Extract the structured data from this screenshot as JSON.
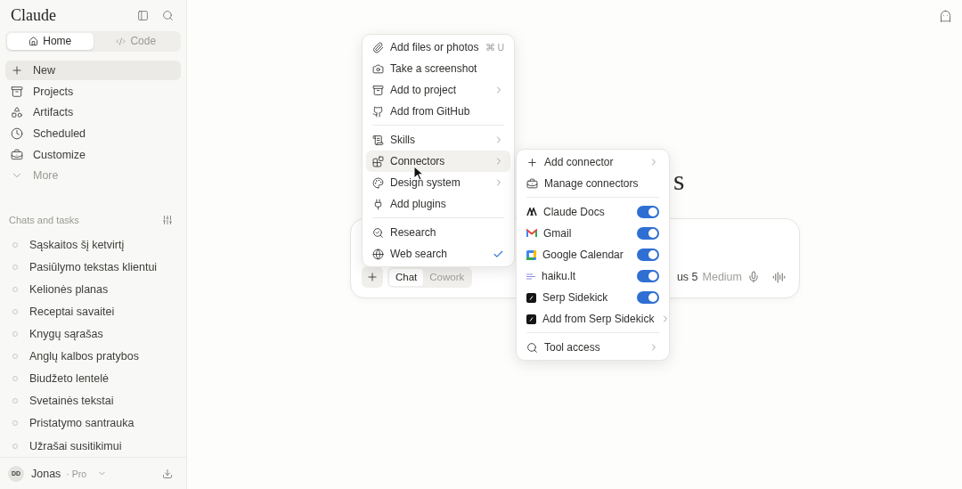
{
  "sidebar": {
    "brand": "Claude",
    "mode_tabs": [
      {
        "label": "Home",
        "selected": true
      },
      {
        "label": "Code",
        "selected": false
      }
    ],
    "nav": [
      {
        "label": "New",
        "selected": true
      },
      {
        "label": "Projects",
        "selected": false
      },
      {
        "label": "Artifacts",
        "selected": false
      },
      {
        "label": "Scheduled",
        "selected": false
      },
      {
        "label": "Customize",
        "selected": false
      },
      {
        "label": "More",
        "selected": false
      }
    ],
    "section_title": "Chats and tasks",
    "chats": [
      "Sąskaitos šį ketvirtį",
      "Pasiūlymo tekstas klientui",
      "Kelionės planas",
      "Receptai savaitei",
      "Knygų sąrašas",
      "Anglų kalbos pratybos",
      "Biudžeto lentelė",
      "Svetainės tekstai",
      "Pristatymo santrauka",
      "Užrašai susitikimui"
    ],
    "user": {
      "initials": "DD",
      "name": "Jonas",
      "plan": "· Pro"
    }
  },
  "main": {
    "heading_fragment": "s",
    "composer": {
      "modes": [
        {
          "label": "Chat",
          "selected": true
        },
        {
          "label": "Cowork",
          "selected": false
        }
      ],
      "model": "us 5",
      "effort": "Medium"
    }
  },
  "menu": {
    "groups": [
      [
        {
          "label": "Add files or photos",
          "shortcut": "⌘ U",
          "submenu": false,
          "selected": false,
          "checked": false
        },
        {
          "label": "Take a screenshot",
          "submenu": false,
          "selected": false,
          "checked": false
        },
        {
          "label": "Add to project",
          "submenu": true,
          "selected": false,
          "checked": false
        },
        {
          "label": "Add from GitHub",
          "submenu": false,
          "selected": false,
          "checked": false
        }
      ],
      [
        {
          "label": "Skills",
          "submenu": true,
          "selected": false,
          "checked": false
        },
        {
          "label": "Connectors",
          "submenu": true,
          "selected": true,
          "checked": false
        },
        {
          "label": "Design system",
          "submenu": true,
          "selected": false,
          "checked": false
        },
        {
          "label": "Add plugins",
          "submenu": false,
          "selected": false,
          "checked": false
        }
      ],
      [
        {
          "label": "Research",
          "submenu": false,
          "selected": false,
          "checked": false
        },
        {
          "label": "Web search",
          "submenu": false,
          "selected": false,
          "checked": true
        }
      ]
    ]
  },
  "connectors_menu": {
    "groups": [
      [
        {
          "kind": "action",
          "label": "Add connector",
          "submenu": true
        },
        {
          "kind": "action",
          "label": "Manage connectors",
          "submenu": false
        }
      ],
      [
        {
          "kind": "toggle",
          "label": "Claude Docs",
          "on": true
        },
        {
          "kind": "toggle",
          "label": "Gmail",
          "on": true
        },
        {
          "kind": "toggle",
          "label": "Google Calendar",
          "on": true
        },
        {
          "kind": "toggle",
          "label": "haiku.lt",
          "on": true
        },
        {
          "kind": "toggle",
          "label": "Serp Sidekick",
          "on": true
        },
        {
          "kind": "action",
          "label": "Add from Serp Sidekick",
          "submenu": true
        }
      ],
      [
        {
          "kind": "action",
          "label": "Tool access",
          "submenu": true
        }
      ]
    ]
  }
}
